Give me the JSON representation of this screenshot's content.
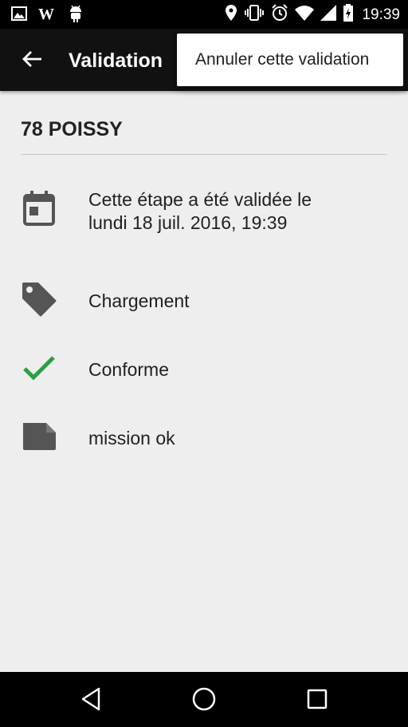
{
  "status_bar": {
    "time": "19:39",
    "icons": [
      "image-icon",
      "wikipedia-icon",
      "android-icon",
      "location-icon",
      "vibrate-icon",
      "alarm-icon",
      "wifi-icon",
      "signal-icon",
      "battery-charging-icon"
    ]
  },
  "app_bar": {
    "title": "Validation",
    "back_icon": "arrow-back-icon"
  },
  "overflow_menu": {
    "items": [
      {
        "label": "Annuler cette validation"
      }
    ]
  },
  "main": {
    "site_title": "78 POISSY",
    "details": [
      {
        "icon": "calendar-icon",
        "line1": "Cette étape a été validée le",
        "line2": "lundi 18 juil. 2016, 19:39"
      },
      {
        "icon": "tag-icon",
        "text": "Chargement"
      },
      {
        "icon": "check-icon",
        "text": "Conforme",
        "icon_color": "#2e9e44"
      },
      {
        "icon": "note-icon",
        "text": "mission ok"
      }
    ]
  },
  "nav_bar": {
    "buttons": [
      "back-triangle-icon",
      "home-circle-icon",
      "recents-square-icon"
    ]
  }
}
